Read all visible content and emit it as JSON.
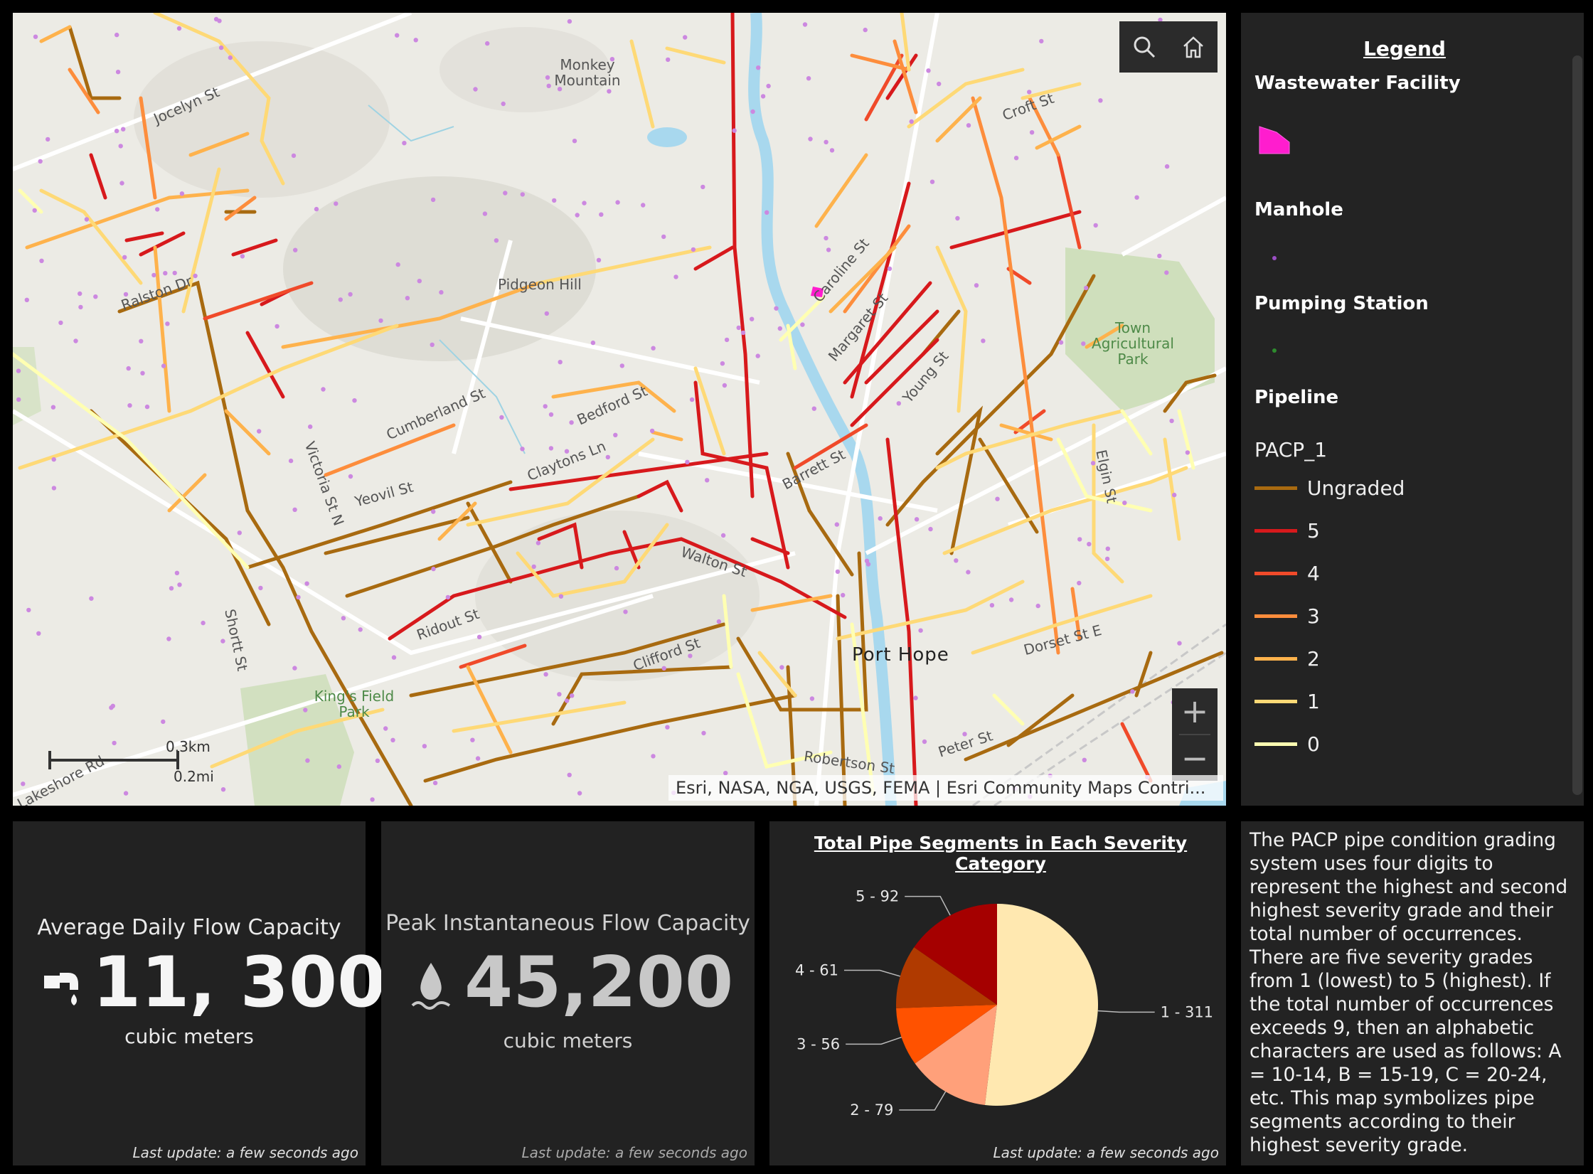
{
  "map": {
    "labels": {
      "monkey_mountain": "Monkey Mountain",
      "pidgeon_hill": "Pidgeon Hill",
      "town_park": "Town Agricultural Park",
      "kings_field": "King's Field Park",
      "port_hope": "Port Hope",
      "jocelyn": "Jocelyn St",
      "ralston": "Ralston Dr",
      "cumberland": "Cumberland St",
      "yeovil": "Yeovil St",
      "victoria": "Victoria St N",
      "claytons": "Claytons Ln",
      "bedford": "Bedford St",
      "barrett": "Barrett St",
      "shortt": "Shortt St",
      "ridout": "Ridout St",
      "clifford": "Clifford St",
      "robertson": "Robertson St",
      "peter": "Peter St",
      "dorset": "Dorset St E",
      "lakeshore": "Lakeshore Rd",
      "walton": "Walton St",
      "croft": "Croft St",
      "elgin": "Elgin St",
      "young": "Young St",
      "caroline": "Caroline St",
      "margaret": "Margaret St"
    },
    "attribution": "Esri, NASA, NGA, USGS, FEMA | Esri Community Maps Contri...",
    "scale_km": "0.3km",
    "scale_mi": "0.2mi",
    "zoom_in": "+",
    "zoom_out": "−",
    "tools": [
      "search-icon",
      "home-icon"
    ]
  },
  "legend": {
    "title": "Legend",
    "wastewater": "Wastewater Facility",
    "manhole": "Manhole",
    "pumping": "Pumping Station",
    "pipeline": "Pipeline",
    "field": "PACP_1",
    "facility_color": "#ff1dce",
    "manhole_color": "#9b4fc4",
    "pumping_color": "#2e8b2e",
    "items": [
      {
        "label": "Ungraded",
        "color": "#a86a10"
      },
      {
        "label": "5",
        "color": "#d7191c"
      },
      {
        "label": "4",
        "color": "#f04a2a"
      },
      {
        "label": "3",
        "color": "#fd8d3c"
      },
      {
        "label": "2",
        "color": "#feb24c"
      },
      {
        "label": "1",
        "color": "#fed976"
      },
      {
        "label": "0",
        "color": "#ffffb2"
      }
    ]
  },
  "card1": {
    "title": "Average Daily Flow Capacity",
    "value": "11, 300",
    "unit": "cubic meters",
    "footer": "Last update: a few seconds ago",
    "icon": "faucet-icon"
  },
  "card2": {
    "title": "Peak Instantaneous Flow Capacity",
    "value": "45,200",
    "unit": "cubic meters",
    "footer": "Last update: a few seconds ago",
    "icon": "water-drop-icon"
  },
  "chart_data": {
    "type": "pie",
    "title": "Total Pipe Segments in Each Severity Category",
    "categories": [
      "1",
      "2",
      "3",
      "4",
      "5"
    ],
    "values": [
      311,
      79,
      56,
      61,
      92
    ],
    "labels": [
      "1 - 311",
      "2 - 79",
      "3 - 56",
      "4 - 61",
      "5 - 92"
    ],
    "colors": [
      "#ffe8b0",
      "#ffa07a",
      "#ff5200",
      "#b03a00",
      "#a50000"
    ],
    "footer": "Last update: a few seconds ago"
  },
  "info": {
    "text": "The PACP pipe condition grading system uses four digits to represent the highest and second highest severity grade and their total number of occurrences. There are five severity grades from 1 (lowest) to 5 (highest). If the total number of occurrences exceeds 9, then an alphabetic characters are used as follows: A = 10-14, B = 15-19, C = 20-24, etc. This map symbolizes pipe segments according to their highest severity grade."
  }
}
